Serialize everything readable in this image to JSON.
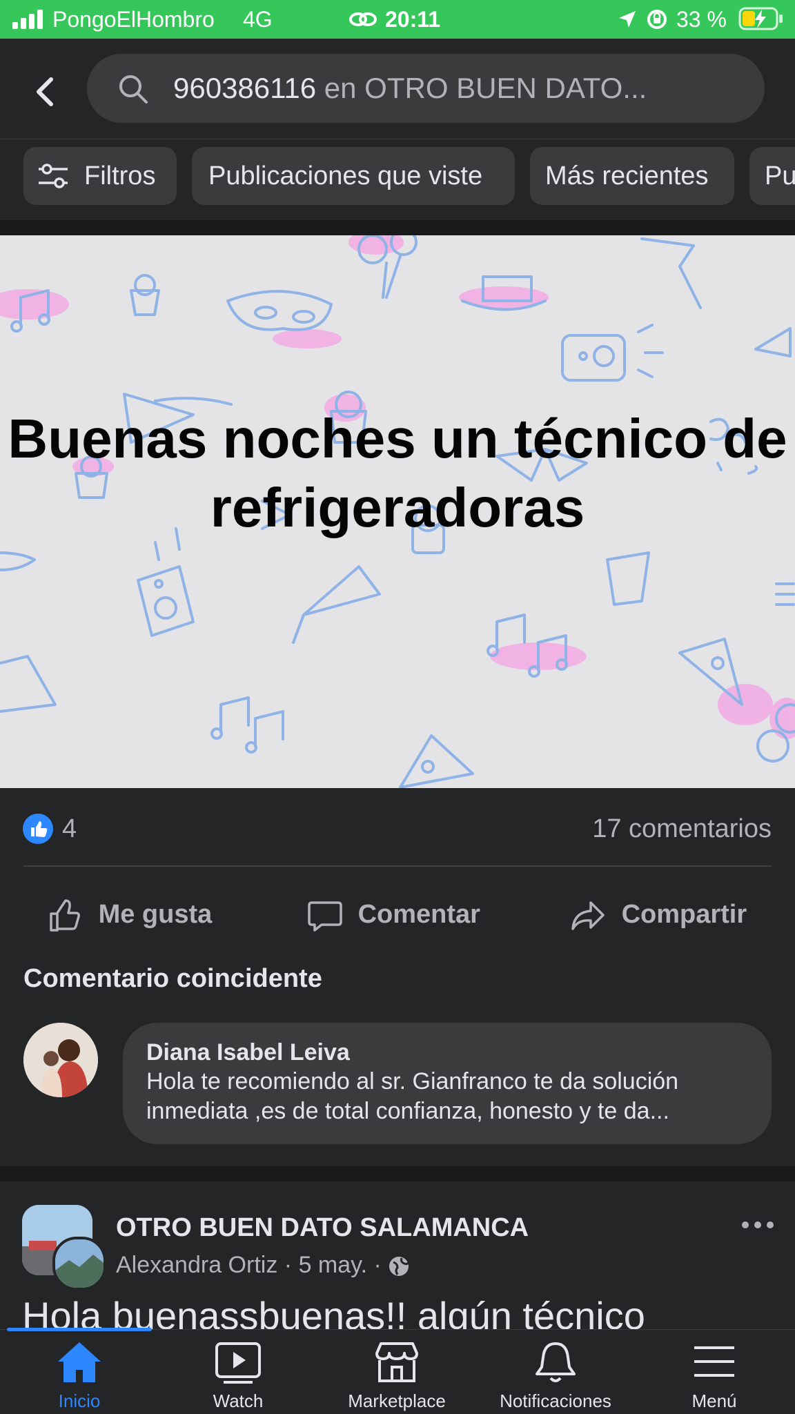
{
  "status_bar": {
    "carrier": "PongoElHombro",
    "network": "4G",
    "time": "20:11",
    "battery": "33 %"
  },
  "search": {
    "query": "960386116",
    "scope": "en OTRO BUEN DATO..."
  },
  "filters": [
    {
      "label": "Filtros"
    },
    {
      "label": "Publicaciones que viste"
    },
    {
      "label": "Más recientes"
    },
    {
      "label": "Pu"
    }
  ],
  "post": {
    "image_text": "Buenas noches un técnico de refrigeradoras",
    "like_count": "4",
    "comment_count": "17 comentarios",
    "actions": {
      "like": "Me gusta",
      "comment": "Comentar",
      "share": "Compartir"
    },
    "matching_comment_title": "Comentario coincidente",
    "comment": {
      "author": "Diana Isabel Leiva",
      "text": "Hola te recomiendo al sr. Gianfranco te da solución inmediata ,es de total confianza, honesto y te da..."
    }
  },
  "next_post": {
    "group": "OTRO BUEN DATO SALAMANCA",
    "author": "Alexandra Ortiz",
    "date": "5 may.",
    "text": "Hola buenassbuenas!!  algún técnico"
  },
  "tabs": [
    {
      "label": "Inicio",
      "active": true
    },
    {
      "label": "Watch"
    },
    {
      "label": "Marketplace"
    },
    {
      "label": "Notificaciones"
    },
    {
      "label": "Menú"
    }
  ],
  "colors": {
    "status_green": "#35c759",
    "facebook_blue": "#2d88ff",
    "background": "#242526",
    "surface": "#3a3b3c"
  }
}
